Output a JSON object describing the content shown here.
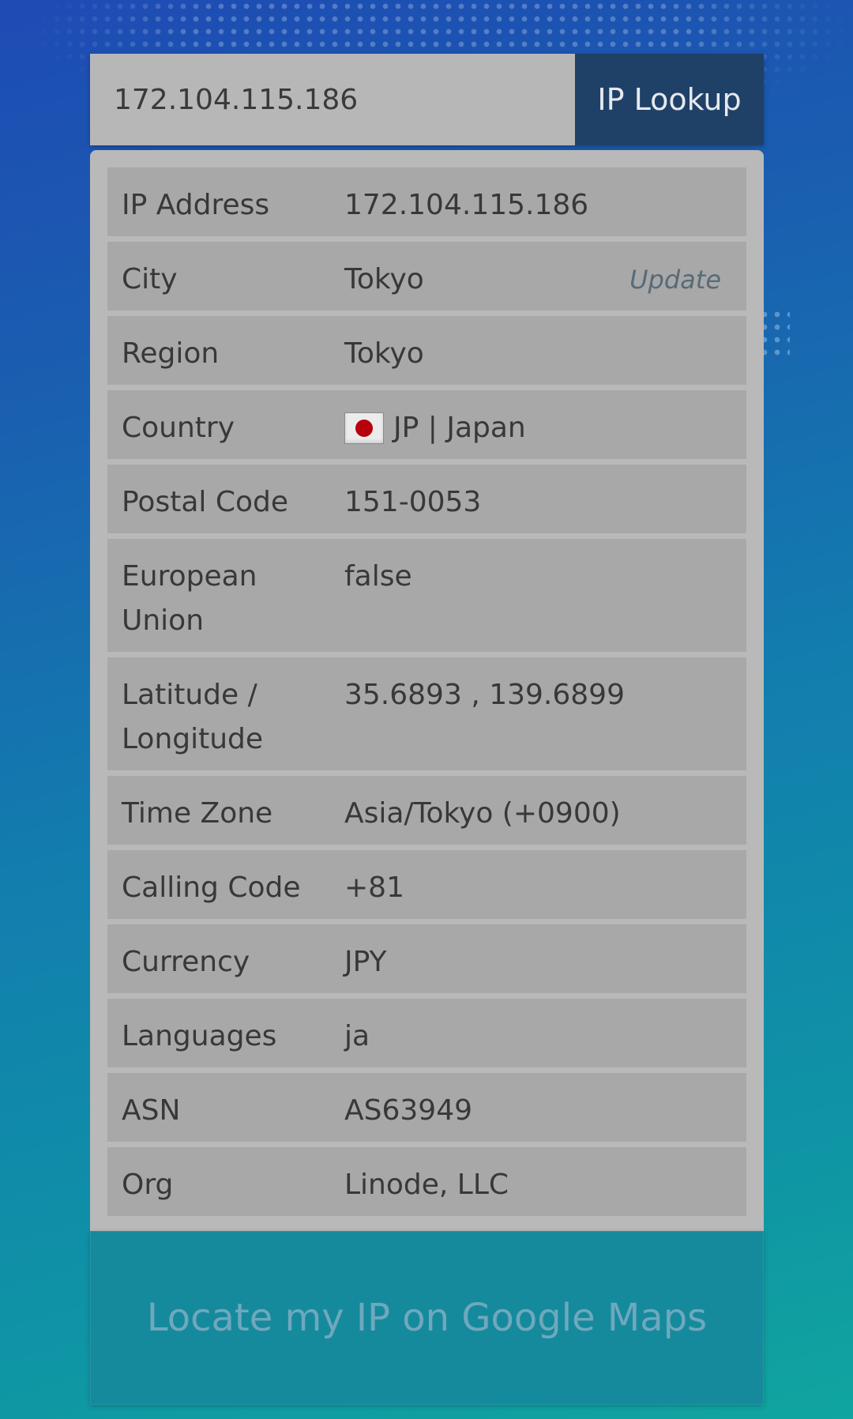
{
  "search": {
    "value": "172.104.115.186",
    "button_label": "IP Lookup"
  },
  "details": {
    "rows": [
      {
        "label": "IP Address",
        "value": "172.104.115.186"
      },
      {
        "label": "City",
        "value": "Tokyo",
        "action": "Update"
      },
      {
        "label": "Region",
        "value": "Tokyo"
      },
      {
        "label": "Country",
        "value": "JP | Japan",
        "icon": "japan-flag-icon"
      },
      {
        "label": "Postal Code",
        "value": "151-0053"
      },
      {
        "label": "European Union",
        "value": "false"
      },
      {
        "label": "Latitude / Longitude",
        "value": "35.6893 , 139.6899"
      },
      {
        "label": "Time Zone",
        "value": "Asia/Tokyo (+0900)"
      },
      {
        "label": "Calling Code",
        "value": "+81"
      },
      {
        "label": "Currency",
        "value": "JPY"
      },
      {
        "label": "Languages",
        "value": "ja"
      },
      {
        "label": "ASN",
        "value": "AS63949"
      },
      {
        "label": "Org",
        "value": "Linode, LLC"
      }
    ]
  },
  "maps_button": {
    "label": "Locate my IP on Google Maps"
  },
  "colors": {
    "lookup_button": "#1f4168",
    "card": "#b9b9b9",
    "row": "#a8a8a8",
    "maps_button": "#168a9d"
  }
}
